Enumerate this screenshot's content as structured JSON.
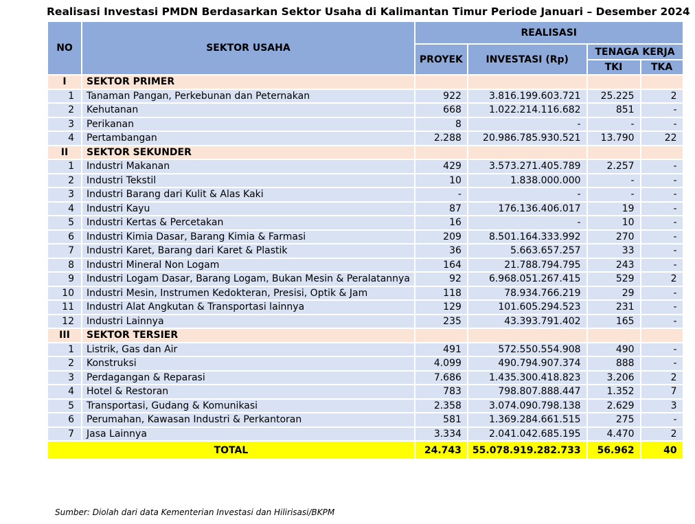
{
  "title": "Realisasi Investasi PMDN Berdasarkan Sektor Usaha di Kalimantan Timur Periode Januari – Desember 2024",
  "headers": {
    "no": "NO",
    "sektor": "SEKTOR USAHA",
    "realisasi": "REALISASI",
    "proyek": "PROYEK",
    "investasi": "INVESTASI (Rp)",
    "tenaga_kerja": "TENAGA KERJA",
    "tki": "TKI",
    "tka": "TKA"
  },
  "sections": [
    {
      "no": "I",
      "name": "SEKTOR PRIMER",
      "rows": [
        {
          "no": "1",
          "name": "Tanaman Pangan, Perkebunan dan Peternakan",
          "proyek": "922",
          "investasi": "3.816.199.603.721",
          "tki": "25.225",
          "tka": "2"
        },
        {
          "no": "2",
          "name": "Kehutanan",
          "proyek": "668",
          "investasi": "1.022.214.116.682",
          "tki": "851",
          "tka": "-"
        },
        {
          "no": "3",
          "name": "Perikanan",
          "proyek": "8",
          "investasi": "-",
          "tki": "-",
          "tka": "-"
        },
        {
          "no": "4",
          "name": "Pertambangan",
          "proyek": "2.288",
          "investasi": "20.986.785.930.521",
          "tki": "13.790",
          "tka": "22"
        }
      ]
    },
    {
      "no": "II",
      "name": "SEKTOR SEKUNDER",
      "rows": [
        {
          "no": "1",
          "name": "Industri Makanan",
          "proyek": "429",
          "investasi": "3.573.271.405.789",
          "tki": "2.257",
          "tka": "-"
        },
        {
          "no": "2",
          "name": "Industri Tekstil",
          "proyek": "10",
          "investasi": "1.838.000.000",
          "tki": "-",
          "tka": "-"
        },
        {
          "no": "3",
          "name": "Industri Barang dari Kulit & Alas Kaki",
          "proyek": "-",
          "investasi": "-",
          "tki": "-",
          "tka": "-"
        },
        {
          "no": "4",
          "name": "Industri Kayu",
          "proyek": "87",
          "investasi": "176.136.406.017",
          "tki": "19",
          "tka": "-"
        },
        {
          "no": "5",
          "name": "Industri Kertas & Percetakan",
          "proyek": "16",
          "investasi": "-",
          "tki": "10",
          "tka": "-"
        },
        {
          "no": "6",
          "name": "Industri Kimia Dasar, Barang Kimia & Farmasi",
          "proyek": "209",
          "investasi": "8.501.164.333.992",
          "tki": "270",
          "tka": "-"
        },
        {
          "no": "7",
          "name": "Industri Karet, Barang dari Karet & Plastik",
          "proyek": "36",
          "investasi": "5.663.657.257",
          "tki": "33",
          "tka": "-"
        },
        {
          "no": "8",
          "name": "Industri Mineral Non Logam",
          "proyek": "164",
          "investasi": "21.788.794.795",
          "tki": "243",
          "tka": "-"
        },
        {
          "no": "9",
          "name": "Industri Logam Dasar, Barang Logam, Bukan Mesin & Peralatannya",
          "proyek": "92",
          "investasi": "6.968.051.267.415",
          "tki": "529",
          "tka": "2"
        },
        {
          "no": "10",
          "name": "Industri Mesin, Instrumen Kedokteran, Presisi, Optik & Jam",
          "proyek": "118",
          "investasi": "78.934.766.219",
          "tki": "29",
          "tka": "-"
        },
        {
          "no": "11",
          "name": "Industri Alat Angkutan & Transportasi lainnya",
          "proyek": "129",
          "investasi": "101.605.294.523",
          "tki": "231",
          "tka": "-"
        },
        {
          "no": "12",
          "name": "Industri Lainnya",
          "proyek": "235",
          "investasi": "43.393.791.402",
          "tki": "165",
          "tka": "-"
        }
      ]
    },
    {
      "no": "III",
      "name": "SEKTOR TERSIER",
      "rows": [
        {
          "no": "1",
          "name": "Listrik, Gas dan Air",
          "proyek": "491",
          "investasi": "572.550.554.908",
          "tki": "490",
          "tka": "-"
        },
        {
          "no": "2",
          "name": "Konstruksi",
          "proyek": "4.099",
          "investasi": "490.794.907.374",
          "tki": "888",
          "tka": "-"
        },
        {
          "no": "3",
          "name": "Perdagangan & Reparasi",
          "proyek": "7.686",
          "investasi": "1.435.300.418.823",
          "tki": "3.206",
          "tka": "2"
        },
        {
          "no": "4",
          "name": "Hotel & Restoran",
          "proyek": "783",
          "investasi": "798.807.888.447",
          "tki": "1.352",
          "tka": "7"
        },
        {
          "no": "5",
          "name": "Transportasi, Gudang & Komunikasi",
          "proyek": "2.358",
          "investasi": "3.074.090.798.138",
          "tki": "2.629",
          "tka": "3"
        },
        {
          "no": "6",
          "name": "Perumahan, Kawasan Industri & Perkantoran",
          "proyek": "581",
          "investasi": "1.369.284.661.515",
          "tki": "275",
          "tka": "-"
        },
        {
          "no": "7",
          "name": "Jasa Lainnya",
          "proyek": "3.334",
          "investasi": "2.041.042.685.195",
          "tki": "4.470",
          "tka": "2"
        }
      ]
    }
  ],
  "total": {
    "label": "TOTAL",
    "proyek": "24.743",
    "investasi": "55.078.919.282.733",
    "tki": "56.962",
    "tka": "40"
  },
  "source": "Sumber: Diolah dari data Kementerian Investasi dan Hilirisasi/BKPM"
}
